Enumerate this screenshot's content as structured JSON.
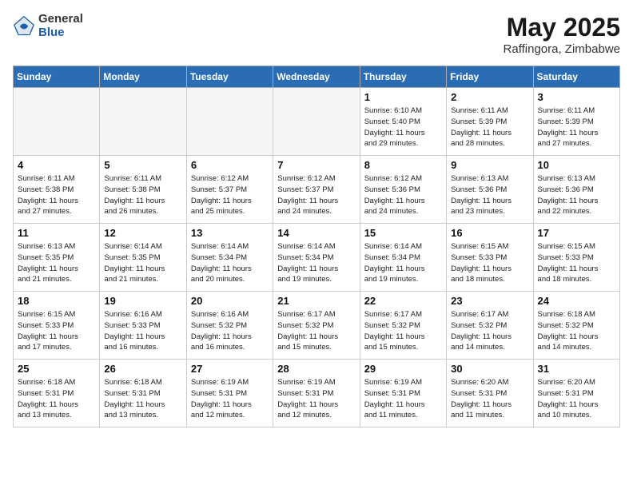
{
  "header": {
    "logo_general": "General",
    "logo_blue": "Blue",
    "month_year": "May 2025",
    "location": "Raffingora, Zimbabwe"
  },
  "days_of_week": [
    "Sunday",
    "Monday",
    "Tuesday",
    "Wednesday",
    "Thursday",
    "Friday",
    "Saturday"
  ],
  "weeks": [
    [
      {
        "day": "",
        "info": "",
        "empty": true
      },
      {
        "day": "",
        "info": "",
        "empty": true
      },
      {
        "day": "",
        "info": "",
        "empty": true
      },
      {
        "day": "",
        "info": "",
        "empty": true
      },
      {
        "day": "1",
        "info": "Sunrise: 6:10 AM\nSunset: 5:40 PM\nDaylight: 11 hours\nand 29 minutes.",
        "empty": false
      },
      {
        "day": "2",
        "info": "Sunrise: 6:11 AM\nSunset: 5:39 PM\nDaylight: 11 hours\nand 28 minutes.",
        "empty": false
      },
      {
        "day": "3",
        "info": "Sunrise: 6:11 AM\nSunset: 5:39 PM\nDaylight: 11 hours\nand 27 minutes.",
        "empty": false
      }
    ],
    [
      {
        "day": "4",
        "info": "Sunrise: 6:11 AM\nSunset: 5:38 PM\nDaylight: 11 hours\nand 27 minutes.",
        "empty": false
      },
      {
        "day": "5",
        "info": "Sunrise: 6:11 AM\nSunset: 5:38 PM\nDaylight: 11 hours\nand 26 minutes.",
        "empty": false
      },
      {
        "day": "6",
        "info": "Sunrise: 6:12 AM\nSunset: 5:37 PM\nDaylight: 11 hours\nand 25 minutes.",
        "empty": false
      },
      {
        "day": "7",
        "info": "Sunrise: 6:12 AM\nSunset: 5:37 PM\nDaylight: 11 hours\nand 24 minutes.",
        "empty": false
      },
      {
        "day": "8",
        "info": "Sunrise: 6:12 AM\nSunset: 5:36 PM\nDaylight: 11 hours\nand 24 minutes.",
        "empty": false
      },
      {
        "day": "9",
        "info": "Sunrise: 6:13 AM\nSunset: 5:36 PM\nDaylight: 11 hours\nand 23 minutes.",
        "empty": false
      },
      {
        "day": "10",
        "info": "Sunrise: 6:13 AM\nSunset: 5:36 PM\nDaylight: 11 hours\nand 22 minutes.",
        "empty": false
      }
    ],
    [
      {
        "day": "11",
        "info": "Sunrise: 6:13 AM\nSunset: 5:35 PM\nDaylight: 11 hours\nand 21 minutes.",
        "empty": false
      },
      {
        "day": "12",
        "info": "Sunrise: 6:14 AM\nSunset: 5:35 PM\nDaylight: 11 hours\nand 21 minutes.",
        "empty": false
      },
      {
        "day": "13",
        "info": "Sunrise: 6:14 AM\nSunset: 5:34 PM\nDaylight: 11 hours\nand 20 minutes.",
        "empty": false
      },
      {
        "day": "14",
        "info": "Sunrise: 6:14 AM\nSunset: 5:34 PM\nDaylight: 11 hours\nand 19 minutes.",
        "empty": false
      },
      {
        "day": "15",
        "info": "Sunrise: 6:14 AM\nSunset: 5:34 PM\nDaylight: 11 hours\nand 19 minutes.",
        "empty": false
      },
      {
        "day": "16",
        "info": "Sunrise: 6:15 AM\nSunset: 5:33 PM\nDaylight: 11 hours\nand 18 minutes.",
        "empty": false
      },
      {
        "day": "17",
        "info": "Sunrise: 6:15 AM\nSunset: 5:33 PM\nDaylight: 11 hours\nand 18 minutes.",
        "empty": false
      }
    ],
    [
      {
        "day": "18",
        "info": "Sunrise: 6:15 AM\nSunset: 5:33 PM\nDaylight: 11 hours\nand 17 minutes.",
        "empty": false
      },
      {
        "day": "19",
        "info": "Sunrise: 6:16 AM\nSunset: 5:33 PM\nDaylight: 11 hours\nand 16 minutes.",
        "empty": false
      },
      {
        "day": "20",
        "info": "Sunrise: 6:16 AM\nSunset: 5:32 PM\nDaylight: 11 hours\nand 16 minutes.",
        "empty": false
      },
      {
        "day": "21",
        "info": "Sunrise: 6:17 AM\nSunset: 5:32 PM\nDaylight: 11 hours\nand 15 minutes.",
        "empty": false
      },
      {
        "day": "22",
        "info": "Sunrise: 6:17 AM\nSunset: 5:32 PM\nDaylight: 11 hours\nand 15 minutes.",
        "empty": false
      },
      {
        "day": "23",
        "info": "Sunrise: 6:17 AM\nSunset: 5:32 PM\nDaylight: 11 hours\nand 14 minutes.",
        "empty": false
      },
      {
        "day": "24",
        "info": "Sunrise: 6:18 AM\nSunset: 5:32 PM\nDaylight: 11 hours\nand 14 minutes.",
        "empty": false
      }
    ],
    [
      {
        "day": "25",
        "info": "Sunrise: 6:18 AM\nSunset: 5:31 PM\nDaylight: 11 hours\nand 13 minutes.",
        "empty": false
      },
      {
        "day": "26",
        "info": "Sunrise: 6:18 AM\nSunset: 5:31 PM\nDaylight: 11 hours\nand 13 minutes.",
        "empty": false
      },
      {
        "day": "27",
        "info": "Sunrise: 6:19 AM\nSunset: 5:31 PM\nDaylight: 11 hours\nand 12 minutes.",
        "empty": false
      },
      {
        "day": "28",
        "info": "Sunrise: 6:19 AM\nSunset: 5:31 PM\nDaylight: 11 hours\nand 12 minutes.",
        "empty": false
      },
      {
        "day": "29",
        "info": "Sunrise: 6:19 AM\nSunset: 5:31 PM\nDaylight: 11 hours\nand 11 minutes.",
        "empty": false
      },
      {
        "day": "30",
        "info": "Sunrise: 6:20 AM\nSunset: 5:31 PM\nDaylight: 11 hours\nand 11 minutes.",
        "empty": false
      },
      {
        "day": "31",
        "info": "Sunrise: 6:20 AM\nSunset: 5:31 PM\nDaylight: 11 hours\nand 10 minutes.",
        "empty": false
      }
    ]
  ]
}
